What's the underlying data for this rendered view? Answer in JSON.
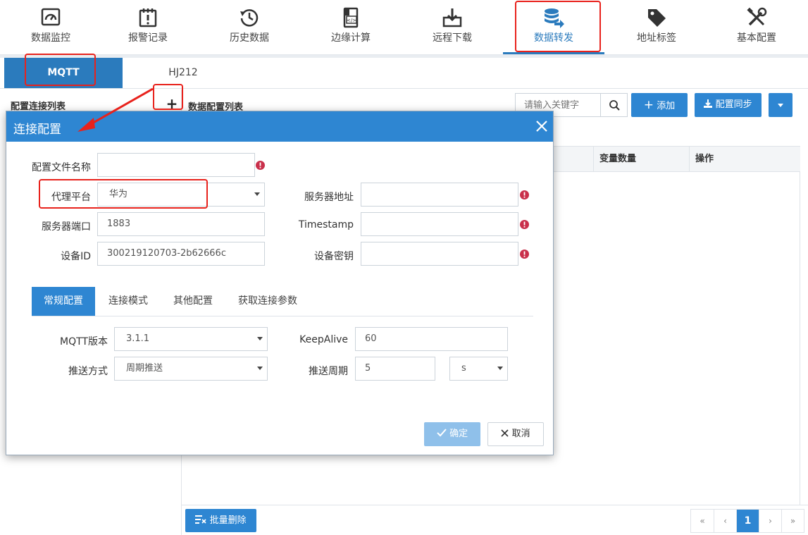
{
  "nav": {
    "items": [
      {
        "label": "数据监控",
        "icon": "gauge-icon"
      },
      {
        "label": "报警记录",
        "icon": "alarm-calendar-icon"
      },
      {
        "label": "历史数据",
        "icon": "history-clock-icon"
      },
      {
        "label": "边缘计算",
        "icon": "code-device-icon"
      },
      {
        "label": "远程下载",
        "icon": "download-icon"
      },
      {
        "label": "数据转发",
        "icon": "database-forward-icon"
      },
      {
        "label": "地址标签",
        "icon": "tag-icon"
      },
      {
        "label": "基本配置",
        "icon": "tools-icon"
      }
    ],
    "active_index": 5
  },
  "protocol_tabs": [
    "MQTT",
    "HJ212"
  ],
  "left_panel": {
    "title": "配置连接列表",
    "add_symbol": "+"
  },
  "right_panel": {
    "title": "数据配置列表",
    "search_placeholder": "请输入关键字",
    "add_label": "添加",
    "sync_label": "配置同步",
    "columns": [
      "变量数量",
      "操作"
    ],
    "batch_delete_label": "批量删除",
    "pager": {
      "first": "«",
      "prev": "‹",
      "current": "1",
      "next": "›",
      "last": "»"
    }
  },
  "modal": {
    "title": "连接配置",
    "fields": {
      "config_name": {
        "label": "配置文件名称",
        "value": ""
      },
      "platform": {
        "label": "代理平台",
        "value": "华为"
      },
      "server_addr": {
        "label": "服务器地址",
        "value": ""
      },
      "server_port": {
        "label": "服务器端口",
        "value": "1883"
      },
      "timestamp": {
        "label": "Timestamp",
        "value": ""
      },
      "device_id": {
        "label": "设备ID",
        "value": "300219120703-2b62666c"
      },
      "device_secret": {
        "label": "设备密钥",
        "value": ""
      }
    },
    "tabs": [
      "常规配置",
      "连接模式",
      "其他配置",
      "获取连接参数"
    ],
    "general": {
      "mqtt_version": {
        "label": "MQTT版本",
        "value": "3.1.1"
      },
      "keepalive": {
        "label": "KeepAlive",
        "value": "60"
      },
      "push_mode": {
        "label": "推送方式",
        "value": "周期推送"
      },
      "push_period": {
        "label": "推送周期",
        "value": "5",
        "unit": "s"
      }
    },
    "ok_label": "确定",
    "cancel_label": "取消"
  },
  "colors": {
    "primary": "#2e86d2",
    "annotation": "#e8221c",
    "required": "#c9304b"
  }
}
